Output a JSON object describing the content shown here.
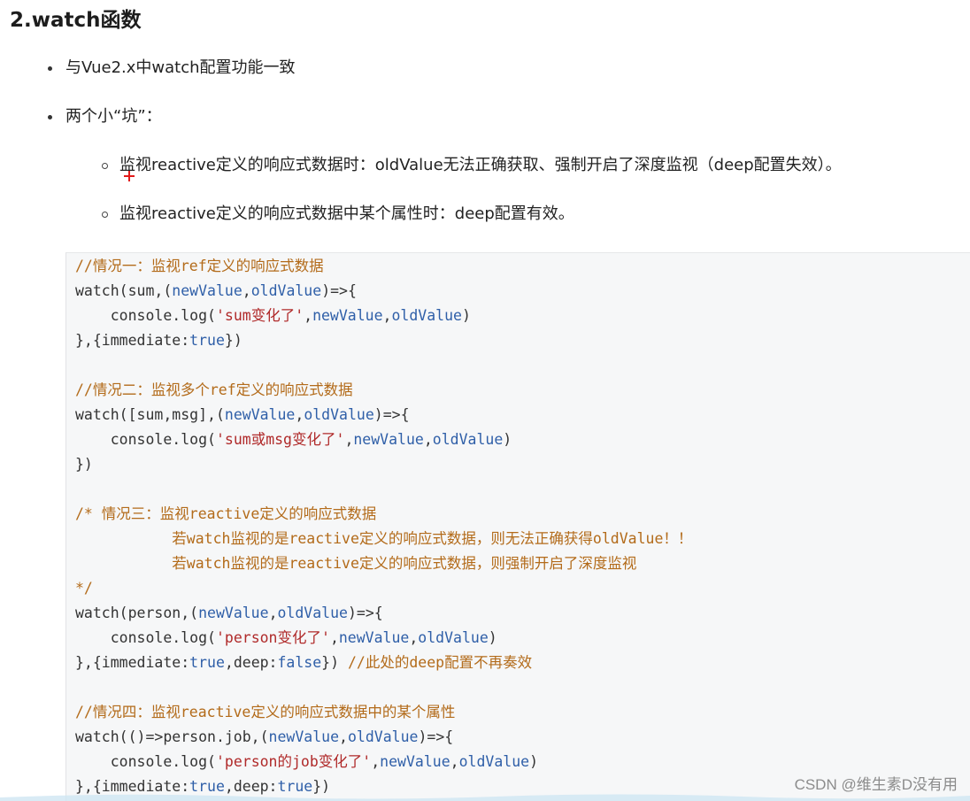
{
  "heading": "2.watch函数",
  "bullets": [
    "与Vue2.x中watch配置功能一致",
    "两个小“坑”："
  ],
  "sub_bullets": [
    "监视reactive定义的响应式数据时：oldValue无法正确获取、强制开启了深度监视（deep配置失效）。",
    "监视reactive定义的响应式数据中某个属性时：deep配置有效。"
  ],
  "code": {
    "c1_comment": "//情况一：监视ref定义的响应式数据",
    "c1_l1_a": "watch(sum,(",
    "c1_l1_p1": "newValue",
    "c1_l1_b": ",",
    "c1_l1_p2": "oldValue",
    "c1_l1_c": ")=>{",
    "c1_l2_a": "    console.log(",
    "c1_l2_s": "'sum变化了'",
    "c1_l2_b": ",",
    "c1_l2_p1": "newValue",
    "c1_l2_c": ",",
    "c1_l2_p2": "oldValue",
    "c1_l2_d": ")",
    "c1_l3_a": "},{immediate:",
    "c1_l3_k": "true",
    "c1_l3_b": "})",
    "c2_comment": "//情况二：监视多个ref定义的响应式数据",
    "c2_l1_a": "watch([sum,msg],(",
    "c2_l1_p1": "newValue",
    "c2_l1_b": ",",
    "c2_l1_p2": "oldValue",
    "c2_l1_c": ")=>{",
    "c2_l2_a": "    console.log(",
    "c2_l2_s": "'sum或msg变化了'",
    "c2_l2_b": ",",
    "c2_l2_p1": "newValue",
    "c2_l2_c": ",",
    "c2_l2_p2": "oldValue",
    "c2_l2_d": ")",
    "c2_l3": "})",
    "c3_comment1": "/* 情况三：监视reactive定义的响应式数据",
    "c3_comment2": "           若watch监视的是reactive定义的响应式数据，则无法正确获得oldValue！！",
    "c3_comment3": "           若watch监视的是reactive定义的响应式数据，则强制开启了深度监视",
    "c3_comment4": "*/",
    "c3_l1_a": "watch(person,(",
    "c3_l1_p1": "newValue",
    "c3_l1_b": ",",
    "c3_l1_p2": "oldValue",
    "c3_l1_c": ")=>{",
    "c3_l2_a": "    console.log(",
    "c3_l2_s": "'person变化了'",
    "c3_l2_b": ",",
    "c3_l2_p1": "newValue",
    "c3_l2_c": ",",
    "c3_l2_p2": "oldValue",
    "c3_l2_d": ")",
    "c3_l3_a": "},{immediate:",
    "c3_l3_k1": "true",
    "c3_l3_b": ",deep:",
    "c3_l3_k2": "false",
    "c3_l3_c": "}) ",
    "c3_l3_comment": "//此处的deep配置不再奏效",
    "c4_comment": "//情况四：监视reactive定义的响应式数据中的某个属性",
    "c4_l1_a": "watch(()=>person.job,(",
    "c4_l1_p1": "newValue",
    "c4_l1_b": ",",
    "c4_l1_p2": "oldValue",
    "c4_l1_c": ")=>{",
    "c4_l2_a": "    console.log(",
    "c4_l2_s": "'person的job变化了'",
    "c4_l2_b": ",",
    "c4_l2_p1": "newValue",
    "c4_l2_c": ",",
    "c4_l2_p2": "oldValue",
    "c4_l2_d": ")",
    "c4_l3_a": "},{immediate:",
    "c4_l3_k1": "true",
    "c4_l3_b": ",deep:",
    "c4_l3_k2": "true",
    "c4_l3_c": "})"
  },
  "watermark": "CSDN @维生素D没有用",
  "colors": {
    "comment": "#b36b1a",
    "param": "#2f5fa8",
    "string": "#b02a2a",
    "code_bg": "#f6f7f8",
    "cursor": "#e21a1a"
  }
}
